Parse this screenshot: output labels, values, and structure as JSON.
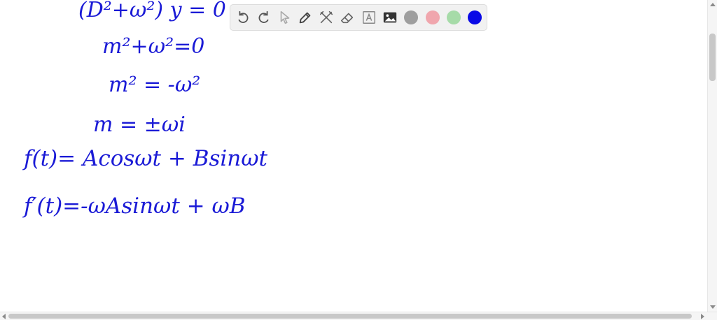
{
  "canvas": {
    "lines": [
      "(D²+ω²) y = 0",
      "m²+ω²=0",
      "m² = -ω²",
      "m = ±ωi",
      "f(t)= Acosωt + Bsinωt",
      "f′(t)=-ωAsinωt + ωB"
    ]
  },
  "toolbar": {
    "tools": [
      "undo-icon",
      "redo-icon",
      "pointer-icon",
      "pen-icon",
      "tools-icon",
      "eraser-icon",
      "text-icon",
      "image-icon"
    ],
    "colors": [
      "#9e9e9e",
      "#f0a6ad",
      "#a6dba8",
      "#0a0ae6"
    ]
  }
}
